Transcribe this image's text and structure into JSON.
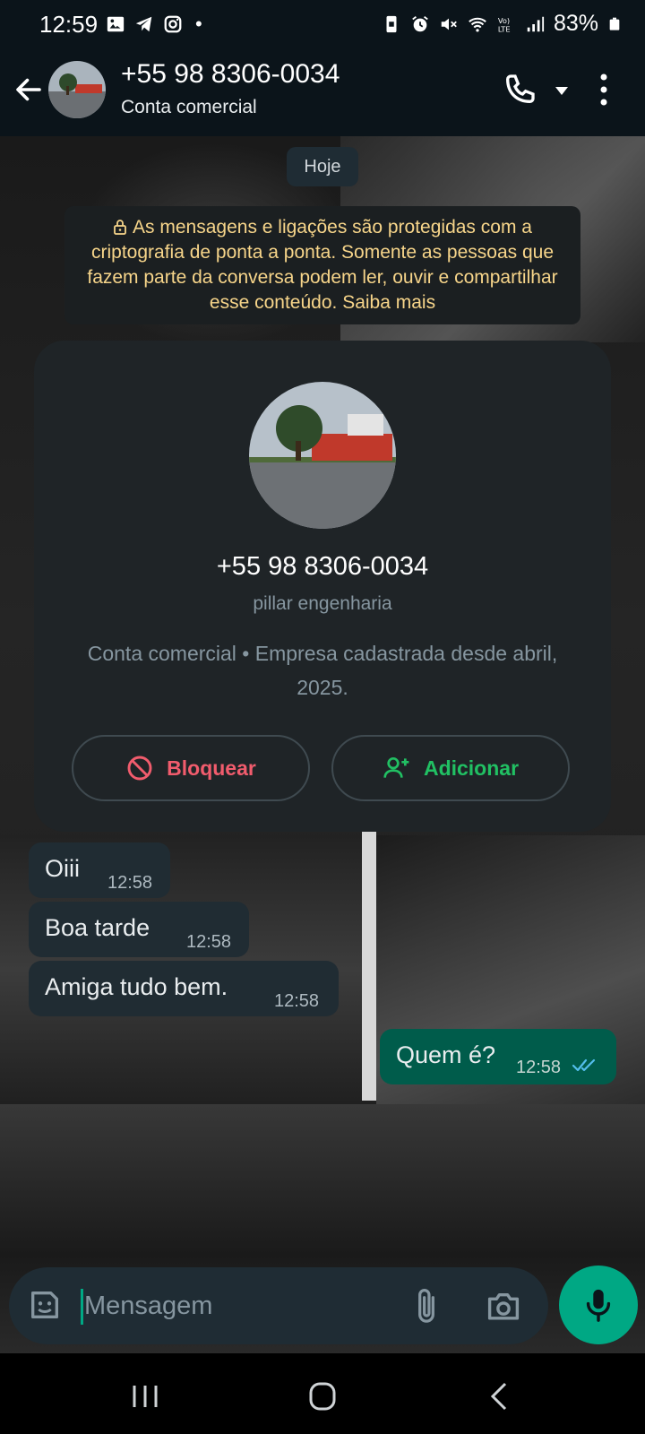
{
  "status_bar": {
    "time": "12:59",
    "dot": "•",
    "battery": "83%",
    "left_icons": [
      "gallery-icon",
      "telegram-icon",
      "instagram-icon"
    ],
    "right_icons": [
      "phone-lock-icon",
      "alarm-icon",
      "mute-icon",
      "wifi-icon",
      "volte-icon",
      "signal-icon",
      "battery-icon"
    ]
  },
  "header": {
    "contact_number": "+55 98 8306-0034",
    "subtitle": "Conta comercial"
  },
  "chat": {
    "date_chip": "Hoje",
    "encryption_notice": "As mensagens e ligações são protegidas com a criptografia de ponta a ponta. Somente as pessoas que fazem parte da conversa podem ler, ouvir e compartilhar esse conteúdo. Saiba mais",
    "profile_card": {
      "number": "+55 98 8306-0034",
      "push_name": "pillar engenharia",
      "info": "Conta comercial • Empresa cadastrada desde abril, 2025.",
      "block_label": "Bloquear",
      "add_label": "Adicionar"
    },
    "messages": [
      {
        "direction": "in",
        "text": "Oiii",
        "time": "12:58"
      },
      {
        "direction": "in",
        "text": "Boa tarde",
        "time": "12:58"
      },
      {
        "direction": "in",
        "text": "Amiga tudo bem.",
        "time": "12:58"
      },
      {
        "direction": "out",
        "text": "Quem é?",
        "time": "12:58",
        "status": "read"
      }
    ]
  },
  "composer": {
    "placeholder": "Mensagem"
  },
  "colors": {
    "accent_green": "#00a884",
    "block_red": "#f15c6d",
    "add_green": "#21c063",
    "read_tick_blue": "#53bdeb",
    "notice_yellow": "#f7d58a"
  }
}
